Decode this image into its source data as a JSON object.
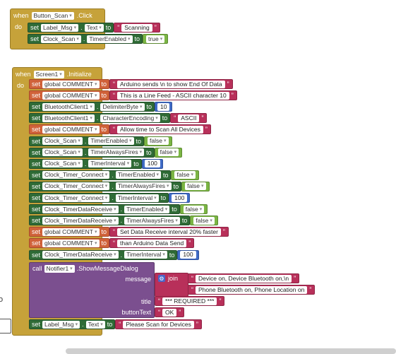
{
  "event1": {
    "when": "when",
    "component": "Button_Scan",
    "event": ".Click",
    "do": "do"
  },
  "scan_rows": [
    {
      "set": "set",
      "comp": "Label_Msg",
      "prop": "Text",
      "to": "to",
      "value": "Scanning",
      "vtype": "str"
    },
    {
      "set": "set",
      "comp": "Clock_Scan",
      "prop": "TimerEnabled",
      "to": "to",
      "value": "true",
      "vtype": "bool"
    }
  ],
  "event2": {
    "when": "when",
    "component": "Screen1",
    "event": ".Initialize",
    "do": "do"
  },
  "init_rows": [
    {
      "kind": "global",
      "set": "set",
      "global": "global COMMENT",
      "to": "to",
      "value": "Arduino sends \\n to show End Of Data",
      "vtype": "str"
    },
    {
      "kind": "global",
      "set": "set",
      "global": "global COMMENT",
      "to": "to",
      "value": "This is a Line Feed - ASCII character 10",
      "vtype": "str"
    },
    {
      "kind": "prop",
      "set": "set",
      "comp": "BluetoothClient1",
      "prop": "DelimiterByte",
      "to": "to",
      "value": "10",
      "vtype": "num"
    },
    {
      "kind": "prop",
      "set": "set",
      "comp": "BluetoothClient1",
      "prop": "CharacterEncoding",
      "to": "to",
      "value": "ASCII",
      "vtype": "str"
    },
    {
      "kind": "global",
      "set": "set",
      "global": "global COMMENT",
      "to": "to",
      "value": "Allow time to Scan All Devices",
      "vtype": "str"
    },
    {
      "kind": "prop",
      "set": "set",
      "comp": "Clock_Scan",
      "prop": "TimerEnabled",
      "to": "to",
      "value": "false",
      "vtype": "bool"
    },
    {
      "kind": "prop",
      "set": "set",
      "comp": "Clock_Scan",
      "prop": "TimerAlwaysFires",
      "to": "to",
      "value": "false",
      "vtype": "bool"
    },
    {
      "kind": "prop",
      "set": "set",
      "comp": "Clock_Scan",
      "prop": "TimerInterval",
      "to": "to",
      "value": "100",
      "vtype": "num"
    },
    {
      "kind": "prop",
      "set": "set",
      "comp": "Clock_Timer_Connect",
      "prop": "TimerEnabled",
      "to": "to",
      "value": "false",
      "vtype": "bool"
    },
    {
      "kind": "prop",
      "set": "set",
      "comp": "Clock_Timer_Connect",
      "prop": "TimerAlwaysFires",
      "to": "to",
      "value": "false",
      "vtype": "bool"
    },
    {
      "kind": "prop",
      "set": "set",
      "comp": "Clock_Timer_Connect",
      "prop": "TimerInterval",
      "to": "to",
      "value": "100",
      "vtype": "num"
    },
    {
      "kind": "prop",
      "set": "set",
      "comp": "Clock_TimerDataReceive",
      "prop": "TimerEnabled",
      "to": "to",
      "value": "false",
      "vtype": "bool"
    },
    {
      "kind": "prop",
      "set": "set",
      "comp": "Clock_TimerDataReceive",
      "prop": "TimerAlwaysFires",
      "to": "to",
      "value": "false",
      "vtype": "bool"
    },
    {
      "kind": "global",
      "set": "set",
      "global": "global COMMENT",
      "to": "to",
      "value": "Set Data Receive interval 20% faster",
      "vtype": "str"
    },
    {
      "kind": "global",
      "set": "set",
      "global": "global COMMENT",
      "to": "to",
      "value": "than Arduino Data Send",
      "vtype": "str"
    },
    {
      "kind": "prop",
      "set": "set",
      "comp": "Clock_TimerDataReceive",
      "prop": "TimerInterval",
      "to": "to",
      "value": "100",
      "vtype": "num"
    }
  ],
  "call": {
    "call": "call",
    "comp": "Notifier1",
    "method": ".ShowMessageDialog",
    "message_label": "message",
    "join": "join",
    "join_items": [
      "Device on, Device Bluetooth on,\\n",
      "Phone Bluetooth on, Phone Location on"
    ],
    "title_label": "title",
    "title_value": "*** REQUIRED ***",
    "button_label": "buttonText",
    "button_value": "OK"
  },
  "last_row": {
    "set": "set",
    "comp": "Label_Msg",
    "prop": "Text",
    "to": "to",
    "value": "Please Scan for Devices"
  },
  "left_glyph": "o",
  "colors": {
    "event": "#c6a23a",
    "component": "#2f6b36",
    "global": "#d0623a",
    "text": "#b8305a",
    "logic": "#7bb544",
    "math": "#3f6bc7",
    "call": "#7b4f8f"
  }
}
